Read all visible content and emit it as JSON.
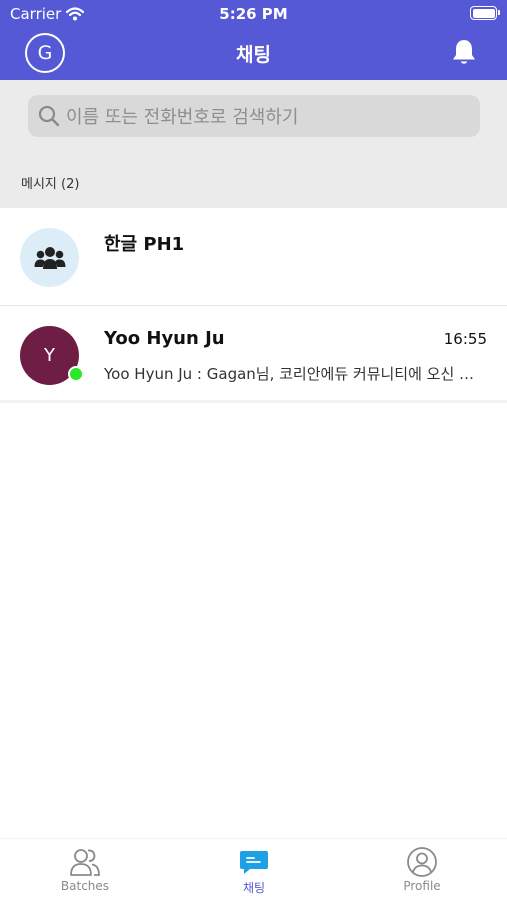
{
  "status_bar": {
    "carrier": "Carrier",
    "time": "5:26 PM"
  },
  "header": {
    "avatar_initial": "G",
    "title": "채팅",
    "accent_color": "#5659d6"
  },
  "search": {
    "placeholder": "이름 또는 전화번호로 검색하기"
  },
  "messages_header": "메시지 (2)",
  "conversations": [
    {
      "name": "한글 PH1",
      "avatar_icon": "group-icon"
    },
    {
      "name": "Yoo Hyun Ju",
      "initial": "Y",
      "time": "16:55",
      "preview": "Yoo Hyun Ju : Gagan님, 코리안에듀 커뮤니티에 오신 것을 환영합니다",
      "online": true,
      "avatar_color": "#6e1d44"
    }
  ],
  "tabs": [
    {
      "label": "Batches",
      "icon": "people-icon"
    },
    {
      "label": "채팅",
      "icon": "chat-bubble-icon",
      "active": true
    },
    {
      "label": "Profile",
      "icon": "profile-icon"
    }
  ]
}
